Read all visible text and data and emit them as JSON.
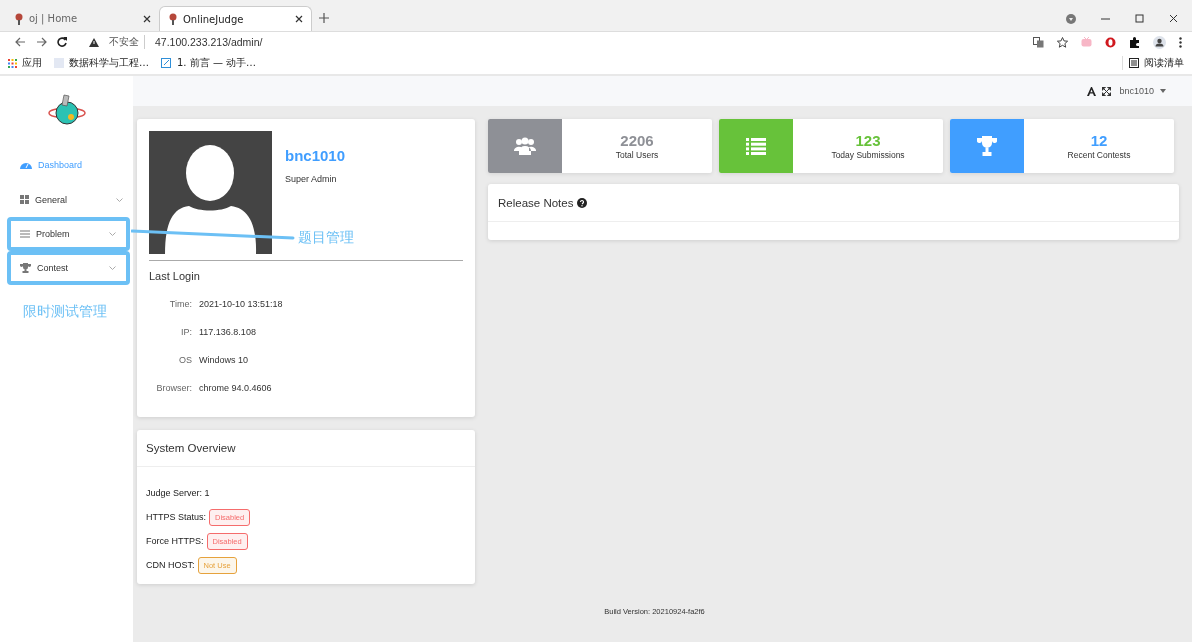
{
  "browser": {
    "tabs": [
      {
        "title": "oj | Home",
        "selected": false
      },
      {
        "title": "OnlineJudge",
        "selected": true
      }
    ],
    "address": {
      "security": "不安全",
      "url": "47.100.233.213/admin/"
    },
    "bookmarks": [
      {
        "kind": "apps",
        "label": "应用"
      },
      {
        "kind": "page",
        "label": "数据科学与工程…"
      },
      {
        "kind": "doc",
        "label": "1. 前言 — 动手…"
      }
    ],
    "reading_list": "阅读清单"
  },
  "header": {
    "user": "bnc1010"
  },
  "sidebar": {
    "items": [
      {
        "kind": "dashboard",
        "label": "Dashboard",
        "selected": true,
        "expandable": false,
        "highlighted": false
      },
      {
        "kind": "general",
        "label": "General",
        "selected": false,
        "expandable": true,
        "highlighted": false
      },
      {
        "kind": "problem",
        "label": "Problem",
        "selected": false,
        "expandable": true,
        "highlighted": true
      },
      {
        "kind": "contest",
        "label": "Contest",
        "selected": false,
        "expandable": true,
        "highlighted": true
      }
    ]
  },
  "annotations": [
    {
      "kind": "callout",
      "text": "题目管理"
    },
    {
      "kind": "label",
      "text": "限时测试管理"
    }
  ],
  "profile": {
    "name": "bnc1010",
    "role": "Super Admin",
    "last_login_title": "Last Login",
    "fields": [
      {
        "label": "Time:",
        "value": "2021-10-10 13:51:18"
      },
      {
        "label": "IP:",
        "value": "117.136.8.108"
      },
      {
        "label": "OS",
        "value": "Windows 10"
      },
      {
        "label": "Browser:",
        "value": "chrome 94.0.4606"
      }
    ]
  },
  "stats": [
    {
      "kind": "users",
      "value": "2206",
      "label": "Total Users",
      "color": "#8e9096"
    },
    {
      "kind": "list",
      "value": "123",
      "label": "Today Submissions",
      "color": "#67c23a"
    },
    {
      "kind": "trophy",
      "value": "12",
      "label": "Recent Contests",
      "color": "#409eff"
    }
  ],
  "release_notes": {
    "title": "Release Notes"
  },
  "system_overview": {
    "title": "System Overview",
    "items": [
      {
        "kind": "text",
        "label": "Judge Server:",
        "value": "1"
      },
      {
        "kind": "tag",
        "label": "HTTPS Status:",
        "value": "Disabled",
        "color": "#f56c6c"
      },
      {
        "kind": "tag",
        "label": "Force HTTPS:",
        "value": "Disabled",
        "color": "#f56c6c"
      },
      {
        "kind": "tag",
        "label": "CDN HOST:",
        "value": "Not Use",
        "color": "#e6a23c"
      }
    ]
  },
  "footer": {
    "build": "Build Version: 20210924-fa2f6"
  }
}
